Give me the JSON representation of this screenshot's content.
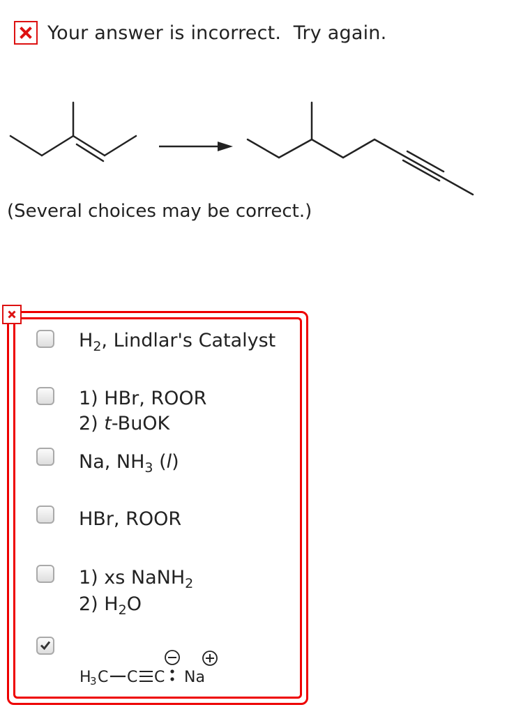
{
  "feedback": {
    "icon": "x-mark-icon",
    "text": "Your answer is incorrect.  Try again."
  },
  "reaction": {
    "arrow_icon": "reaction-arrow-icon"
  },
  "hint": "(Several choices may be correct.)",
  "colors": {
    "error": "#e00000",
    "text": "#222222",
    "checkbox_border": "#a9a9a9"
  },
  "choices": [
    {
      "checked": false,
      "pre": "H",
      "sub": "2",
      "post": ", Lindlar's Catalyst"
    },
    {
      "checked": false,
      "line1": "1) HBr, ROOR",
      "line2_pre": "2) ",
      "line2_it": "t",
      "line2_post": "-BuOK"
    },
    {
      "checked": false,
      "pre": "Na, NH",
      "sub": "3",
      "mid": " (",
      "it": "l",
      "post": ")"
    },
    {
      "checked": false,
      "text": "HBr, ROOR"
    },
    {
      "checked": false,
      "line1_pre": "1) xs NaNH",
      "line1_sub": "2",
      "line2_pre": "2) H",
      "line2_sub": "2",
      "line2_post": "O"
    },
    {
      "checked": true,
      "formula": {
        "h": "H",
        "three": "3",
        "c1": "C",
        "c2": "C",
        "c3": "C",
        "na": "Na",
        "minus": "−",
        "plus": "+"
      }
    }
  ]
}
